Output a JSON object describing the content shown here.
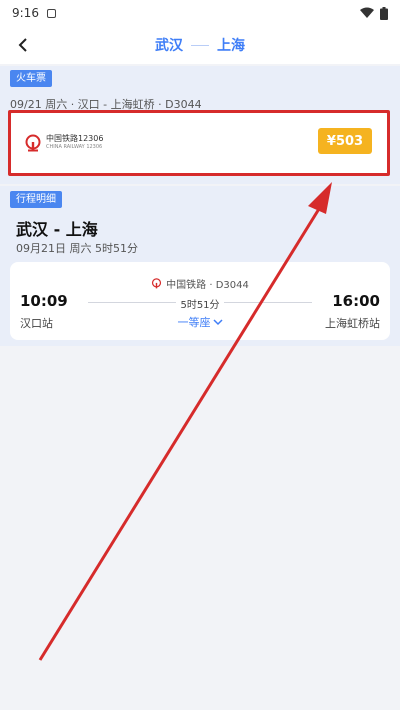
{
  "status": {
    "time": "9:16"
  },
  "nav": {
    "from": "武汉",
    "to": "上海"
  },
  "train_ticket": {
    "tag": "火车票",
    "info_line": "09/21 周六 · 汉口 - 上海虹桥 · D3044",
    "provider_name": "中国铁路12306",
    "provider_sub": "CHINA RAILWAY 12306",
    "price": "¥503"
  },
  "itinerary": {
    "tag": "行程明细",
    "title": "武汉 - 上海",
    "subtitle": "09月21日 周六   5时51分",
    "train_label": "中国铁路 · D3044",
    "departure_time": "10:09",
    "departure_station": "汉口站",
    "duration": "5时51分",
    "seat_class": "一等座",
    "arrival_time": "16:00",
    "arrival_station": "上海虹桥站"
  },
  "colors": {
    "accent": "#3f7ef7",
    "price": "#f5b320",
    "annotation": "#d62b2b"
  }
}
